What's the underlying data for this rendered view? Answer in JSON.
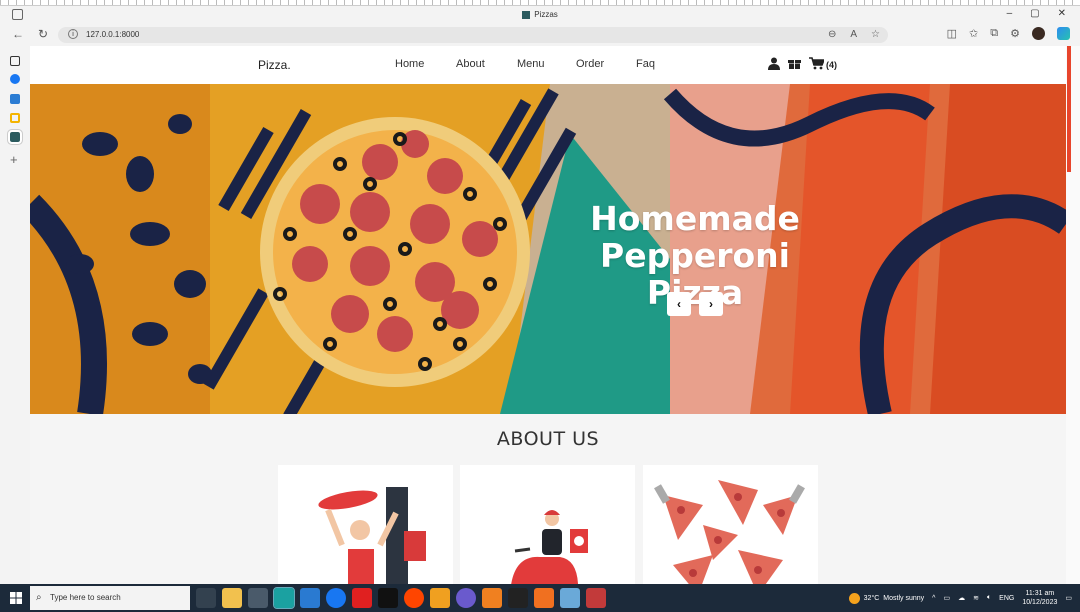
{
  "browser": {
    "tab_title": "Pizzas",
    "url": "127.0.0.1:8000",
    "window_controls": [
      "–",
      "▢",
      "✕"
    ]
  },
  "site": {
    "brand": "Pizza.",
    "menu": [
      "Home",
      "About",
      "Menu",
      "Order",
      "Faq"
    ],
    "cart_count": "(4)"
  },
  "hero": {
    "title_line1": "Homemade",
    "title_line2": "Pepperoni Pizza",
    "prev_label": "‹",
    "next_label": "›"
  },
  "about": {
    "title": "ABOUT US"
  },
  "taskbar": {
    "search_placeholder": "Type here to search",
    "temperature": "32°C",
    "weather": "Mostly sunny",
    "language": "ENG",
    "time": "11:31 am",
    "date": "10/12/2023"
  },
  "colors": {
    "accent": "#e8452c",
    "hero_orange": "#d9891c",
    "hero_teal": "#1f9a86",
    "hero_navy": "#1a2346",
    "taskbar": "#1c2a3a"
  }
}
